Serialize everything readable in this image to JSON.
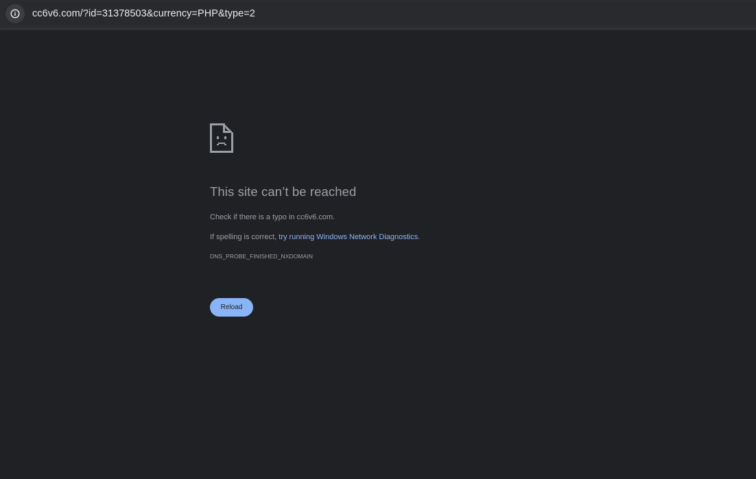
{
  "browser": {
    "url": "cc6v6.com/?id=31378503&currency=PHP&type=2",
    "site_info_icon": "info-icon"
  },
  "error": {
    "icon": "sad-page-icon",
    "title": "This site can’t be reached",
    "message1": "Check if there is a typo in cc6v6.com.",
    "message2_prefix": "If spelling is correct, ",
    "message2_link": "try running Windows Network Diagnostics",
    "message2_suffix": ".",
    "error_code": "DNS_PROBE_FINISHED_NXDOMAIN",
    "reload_label": "Reload"
  },
  "colors": {
    "background": "#202124",
    "accent": "#8ab4f8",
    "text": "#9aa0a6"
  }
}
